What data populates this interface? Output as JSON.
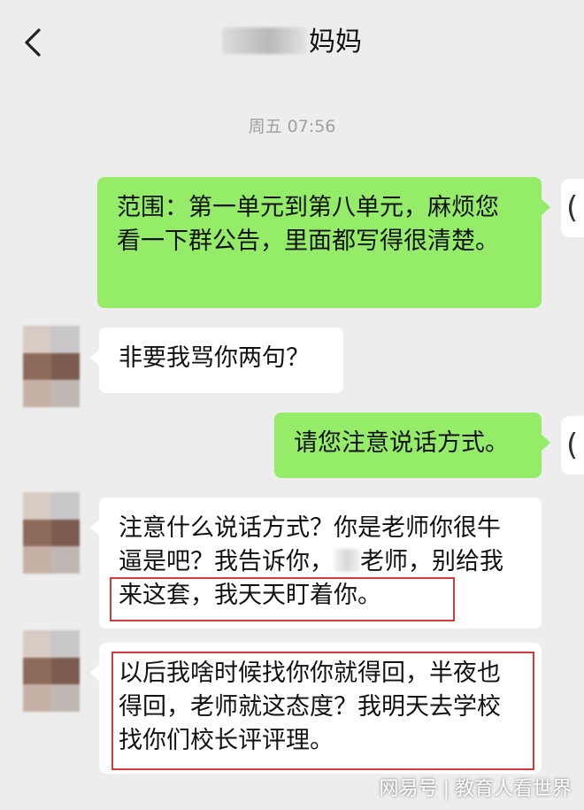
{
  "header": {
    "back_icon": "chevron-left-icon",
    "title_suffix": "妈妈"
  },
  "timestamp": "周五 07:56",
  "messages": [
    {
      "sender": "me",
      "text": "范围：第一单元到第八单元，麻烦您看一下群公告，里面都写得很清楚。"
    },
    {
      "sender": "other",
      "text": "非要我骂你两句？"
    },
    {
      "sender": "me",
      "text": "请您注意说话方式。"
    },
    {
      "sender": "other",
      "text_a": "注意什么说话方式？你是老师你很牛逼是吧？我告诉你，",
      "text_b": "老师，别给我来这套，我天天盯着你。"
    },
    {
      "sender": "other",
      "text": "以后我啥时候找你你就得回，半夜也得回，老师就这态度？我明天去学校找你们校长评评理。"
    }
  ],
  "my_avatar_glyph": "(",
  "watermark": {
    "brand": "网易号",
    "separator": "|",
    "account": "教育人看世界"
  },
  "colors": {
    "background": "#ededed",
    "my_bubble": "#95ec69",
    "other_bubble": "#ffffff",
    "highlight": "#d43a3a"
  }
}
